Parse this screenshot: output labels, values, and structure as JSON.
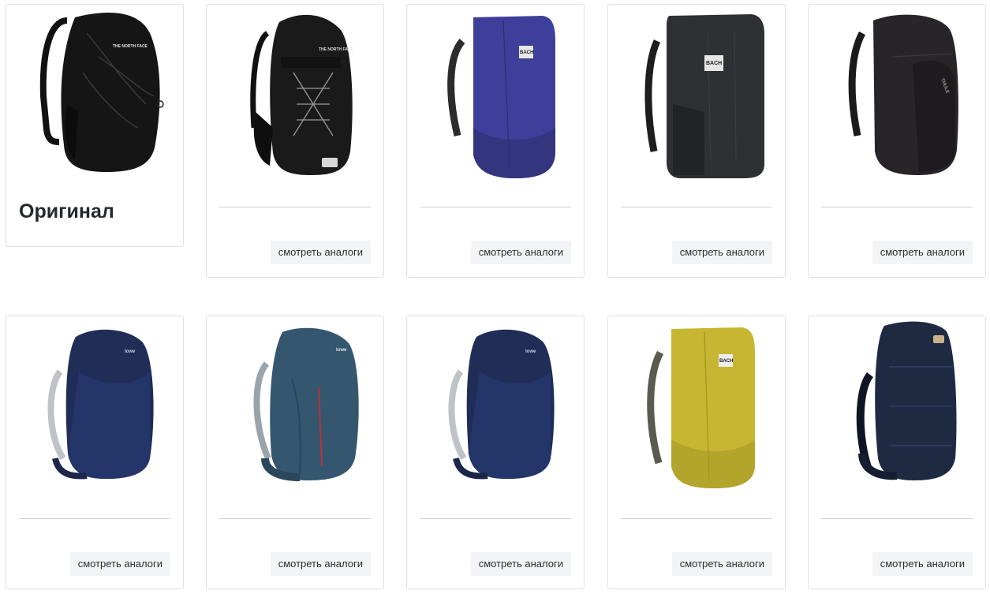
{
  "original": {
    "title": "Оригинал",
    "product": {
      "name": "backpack-black-rounded",
      "logo": "THE NORTH FACE"
    }
  },
  "analog_button_label": "смотреть аналоги",
  "row1": [
    {
      "image": "backpack-black-bungee",
      "color": "#1c1c1c"
    },
    {
      "image": "backpack-indigo-panel",
      "color": "#3e3f9a",
      "logo": "BACH"
    },
    {
      "image": "backpack-charcoal-square",
      "color": "#2f3034",
      "logo": "BACH"
    },
    {
      "image": "backpack-dark-slim",
      "color": "#27242a",
      "logo": "THULE"
    }
  ],
  "row2": [
    {
      "image": "backpack-navy-hiking",
      "color": "#1f2d57"
    },
    {
      "image": "backpack-teal-hiking",
      "color": "#34566e"
    },
    {
      "image": "backpack-navy-hiking-2",
      "color": "#1f2d57"
    },
    {
      "image": "backpack-mustard-panel",
      "color": "#c6b631",
      "logo": "BACH"
    },
    {
      "image": "backpack-navy-trekking",
      "color": "#1e2a42"
    }
  ]
}
